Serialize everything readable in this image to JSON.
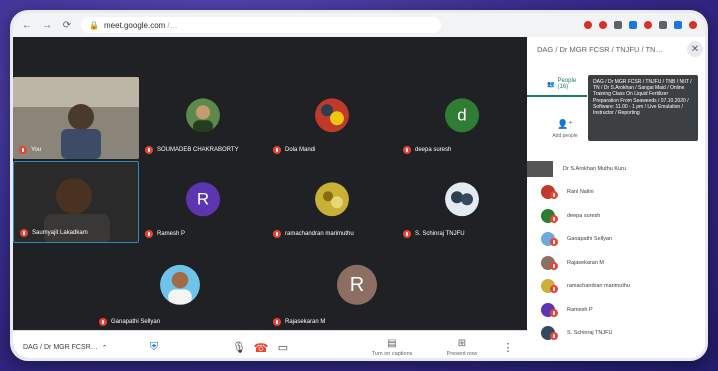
{
  "browser": {
    "url": "meet.google.com",
    "url_suffix": "/…",
    "nav_back": "←",
    "nav_forward": "→",
    "nav_reload": "⟳"
  },
  "tiles": [
    {
      "id": "you",
      "name": "You",
      "kind": "photo",
      "colors": [
        "#6d6a63",
        "#3a352f"
      ]
    },
    {
      "id": "soumadeb",
      "name": "SOUMADEB CHAKRABORTY",
      "kind": "photo-avatar",
      "colors": [
        "#5d8a4a",
        "#243d1f"
      ]
    },
    {
      "id": "dola",
      "name": "Dola Mandi",
      "kind": "photo-avatar",
      "colors": [
        "#c0392b",
        "#2c3e50"
      ]
    },
    {
      "id": "deepa",
      "name": "deepa suresh",
      "kind": "letter",
      "letter": "d",
      "color": "#2e7d32"
    },
    {
      "id": "saumyajit",
      "name": "Saumyajit Lakadkam",
      "kind": "photo",
      "colors": [
        "#2b2b2b",
        "#4a3f35"
      ]
    },
    {
      "id": "ramesh",
      "name": "Ramesh P",
      "kind": "letter",
      "letter": "R",
      "color": "#5e35b1"
    },
    {
      "id": "ramachandran",
      "name": "ramachandran marimuthu",
      "kind": "photo-avatar",
      "colors": [
        "#f0d060",
        "#8a6a10"
      ]
    },
    {
      "id": "schinnaraj",
      "name": "S. Schinraj TNJFU",
      "kind": "photo-avatar",
      "colors": [
        "#e3eaf2",
        "#2c3e50"
      ]
    },
    {
      "id": "ganapathi",
      "name": "Ganapathi Sellyan",
      "kind": "photo-avatar",
      "colors": [
        "#6fc3e8",
        "#2a6a8a"
      ]
    },
    {
      "id": "rajasekaran",
      "name": "Rajasekaran M",
      "kind": "letter",
      "letter": "R",
      "color": "#8d6e63"
    }
  ],
  "toolbar": {
    "meeting_title": "DAG / Dr MGR FCSR…",
    "present_now": "Present now",
    "turn_on_captions": "Turn on captions"
  },
  "panel": {
    "title": "DAG / Dr MGR FCSR / TNJFU / TN…",
    "tab_people": "People (16)",
    "add_people": "Add people",
    "tooltip": "DAG / Dr MGR FCSR / TNJFU / TNB / NIIT / TN / Dr S.Arokhan / Sangai Maid / Online Training Class On Liquid Fertilizer Preparation From Seaweeds / 07.10.2020 / Software: 11.00 - 1 pm / Live Emulation / Instructor / Reporting",
    "close_label": "✕",
    "participants": [
      {
        "name": "Dr S.Arokhan Muthu Kuru",
        "color": "#666",
        "you": true
      },
      {
        "name": "Rani Nalini",
        "color": "#c0392b"
      },
      {
        "name": "deepa suresh",
        "color": "#2e7d32"
      },
      {
        "name": "Ganapathi Sellyan",
        "color": "#6fa8dc"
      },
      {
        "name": "Rajasekaran M",
        "color": "#8d6e63"
      },
      {
        "name": "ramachandran marimuthu",
        "color": "#c9b037"
      },
      {
        "name": "Ramesh P",
        "color": "#5e35b1"
      },
      {
        "name": "S. Schinraj TNJFU",
        "color": "#34495e"
      }
    ]
  }
}
